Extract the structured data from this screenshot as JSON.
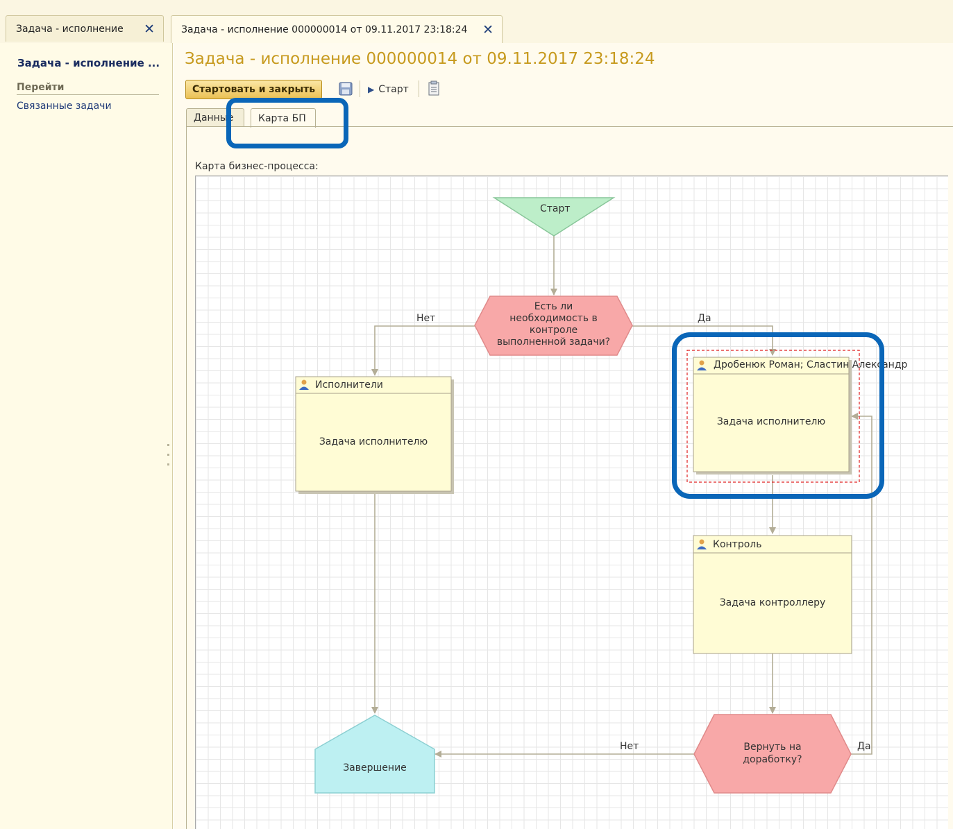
{
  "window_tabs": [
    {
      "label": "Задача - исполнение",
      "close": "✕"
    },
    {
      "label": "Задача - исполнение 000000014 от 09.11.2017 23:18:24",
      "close": "✕"
    }
  ],
  "left_panel": {
    "title": "Задача - исполнение ...",
    "section": "Перейти",
    "link": "Связанные задачи"
  },
  "header": {
    "title": "Задача - исполнение 000000014 от 09.11.2017 23:18:24"
  },
  "toolbar": {
    "start_close_label": "Стартовать и закрыть",
    "start_label": "Старт"
  },
  "inner_tabs": {
    "data_label": "Данные",
    "map_label": "Карта БП"
  },
  "map": {
    "caption": "Карта бизнес-процесса:",
    "start": "Старт",
    "condition1": [
      "Есть ли",
      "необходимость в",
      "контроле",
      "выполненной задачи?"
    ],
    "cond1_no": "Нет",
    "cond1_yes": "Да",
    "task_executors": {
      "header": "Исполнители",
      "body": "Задача исполнителю"
    },
    "task_assigned": {
      "header": "Дробенюк Роман; Сластин Александр",
      "body": "Задача исполнителю"
    },
    "task_control": {
      "header": "Контроль",
      "body": "Задача контроллеру"
    },
    "condition2": [
      "Вернуть на",
      "доработку?"
    ],
    "cond2_no": "Нет",
    "cond2_yes": "Да",
    "end": "Завершение"
  },
  "colors": {
    "accent": "#c79a1e",
    "highlight": "#0a66b8",
    "start_fill": "#bdeec9",
    "condition_fill": "#f8a8a8",
    "task_fill": "#fffcd5",
    "end_fill": "#bdf0f2"
  }
}
